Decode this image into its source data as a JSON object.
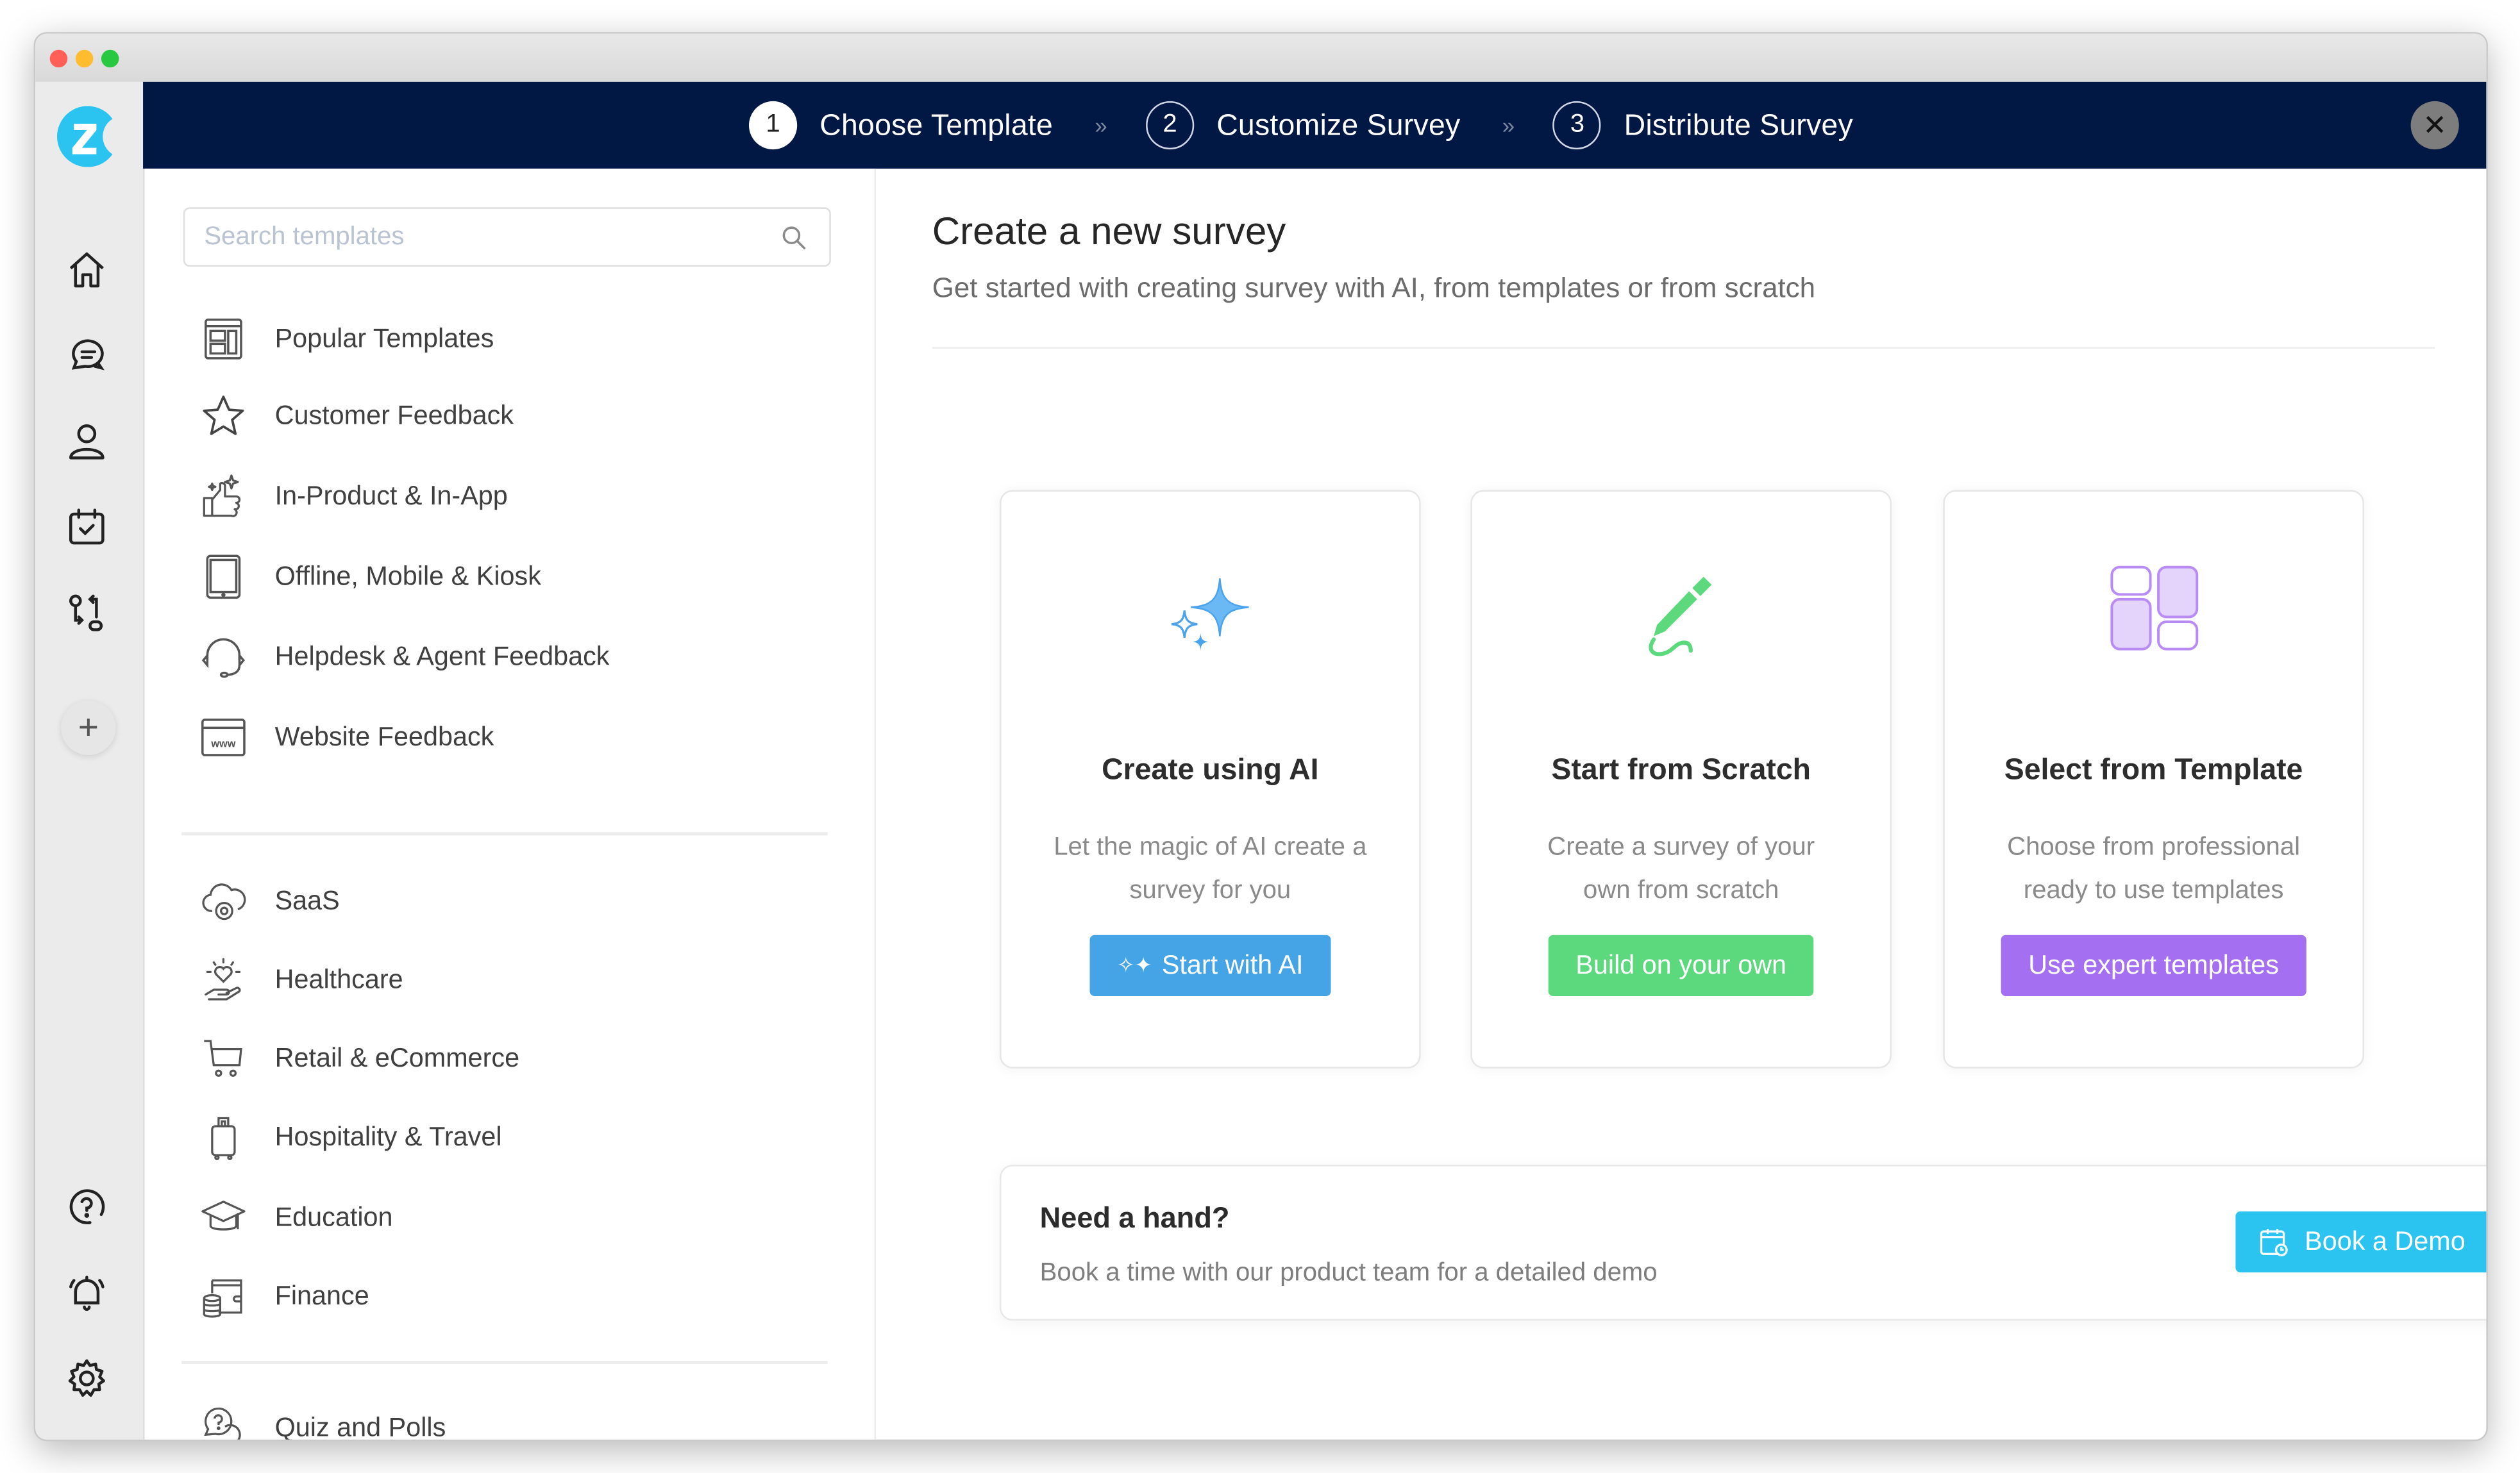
{
  "window": {
    "traffic_lights": {
      "close": "#ff5f57",
      "minimize": "#febc2e",
      "maximize": "#28c840"
    }
  },
  "rail": {
    "logo_letter": "z",
    "logo_color": "#2bc4f0",
    "items": [
      {
        "icon": "home-icon",
        "label": "Home"
      },
      {
        "icon": "chat-icon",
        "label": "Feedback"
      },
      {
        "icon": "user-icon",
        "label": "Contacts"
      },
      {
        "icon": "calendar-check-icon",
        "label": "Tasks"
      },
      {
        "icon": "workflow-icon",
        "label": "Workflows"
      },
      {
        "icon": "plus-icon",
        "label": "+"
      }
    ],
    "bottom_items": [
      {
        "icon": "help-icon"
      },
      {
        "icon": "bell-icon"
      },
      {
        "icon": "gear-icon"
      }
    ]
  },
  "topbar": {
    "background": "#001843",
    "steps": [
      {
        "number": "1",
        "label": "Choose Template",
        "active": true
      },
      {
        "number": "2",
        "label": "Customize Survey",
        "active": false
      },
      {
        "number": "3",
        "label": "Distribute Survey",
        "active": false
      }
    ],
    "separator": "»",
    "close_icon": "✕"
  },
  "sidebar": {
    "search_placeholder": "Search templates",
    "search_value": "",
    "groups": [
      [
        {
          "icon": "layout-icon",
          "label": "Popular Templates"
        },
        {
          "icon": "star-icon",
          "label": "Customer Feedback"
        },
        {
          "icon": "thumbs-up-sparkle-icon",
          "label": "In-Product & In-App"
        },
        {
          "icon": "tablet-icon",
          "label": "Offline, Mobile & Kiosk"
        },
        {
          "icon": "headset-icon",
          "label": "Helpdesk & Agent Feedback"
        },
        {
          "icon": "website-icon",
          "label": "Website Feedback"
        }
      ],
      [
        {
          "icon": "cloud-gear-icon",
          "label": "SaaS"
        },
        {
          "icon": "heart-hand-icon",
          "label": "Healthcare"
        },
        {
          "icon": "cart-icon",
          "label": "Retail & eCommerce"
        },
        {
          "icon": "luggage-icon",
          "label": "Hospitality & Travel"
        },
        {
          "icon": "graduation-cap-icon",
          "label": "Education"
        },
        {
          "icon": "wallet-coins-icon",
          "label": "Finance"
        }
      ],
      [
        {
          "icon": "quiz-bubble-icon",
          "label": "Quiz and Polls"
        }
      ]
    ]
  },
  "main": {
    "title": "Create a new survey",
    "subtitle": "Get started with creating survey with AI, from templates or from scratch",
    "cards": [
      {
        "icon": "sparkles-icon",
        "title": "Create using AI",
        "description": "Let the magic of AI create a survey for you",
        "button": "Start with AI",
        "button_color": "#45a4e6"
      },
      {
        "icon": "pen-icon",
        "title": "Start from Scratch",
        "description": "Create a survey of your own from scratch",
        "button": "Build on your own",
        "button_color": "#5cd87d"
      },
      {
        "icon": "template-grid-icon",
        "title": "Select from Template",
        "description": "Choose from professional ready to use templates",
        "button": "Use expert templates",
        "button_color": "#a56ff2"
      }
    ],
    "help": {
      "title": "Need a hand?",
      "description": "Book a time with our product team for a detailed demo",
      "button": "Book a Demo",
      "button_color": "#2bc4f0"
    }
  }
}
